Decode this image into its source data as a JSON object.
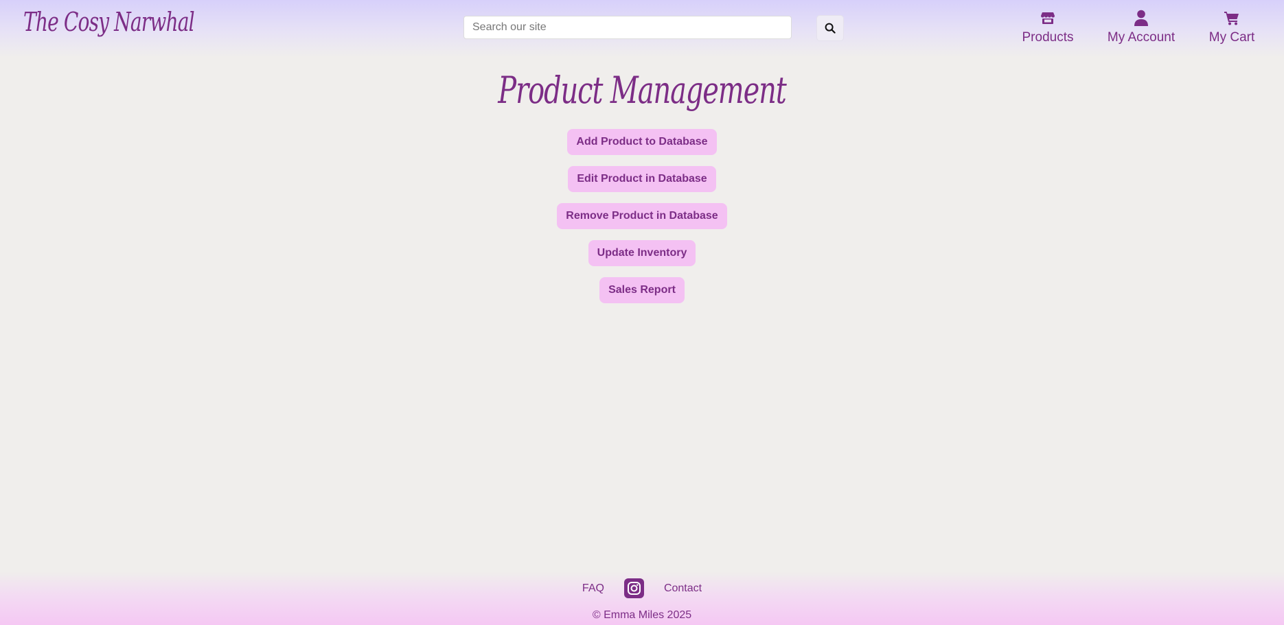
{
  "header": {
    "logo_text": "The Cosy Narwhal",
    "search": {
      "placeholder": "Search our site",
      "value": "",
      "button_icon": "search-icon"
    },
    "nav": [
      {
        "label": "Products",
        "icon": "store-icon"
      },
      {
        "label": "My Account",
        "icon": "user-icon"
      },
      {
        "label": "My Cart",
        "icon": "cart-icon"
      }
    ]
  },
  "main": {
    "title": "Product Management",
    "buttons": [
      {
        "label": "Add Product to Database"
      },
      {
        "label": "Edit Product in Database"
      },
      {
        "label": "Remove Product in Database"
      },
      {
        "label": "Update Inventory"
      },
      {
        "label": "Sales Report"
      }
    ]
  },
  "footer": {
    "links": [
      {
        "label": "FAQ"
      },
      {
        "label": "Contact"
      }
    ],
    "social_icon": "instagram-icon",
    "copyright": "© Emma Miles 2025"
  },
  "colors": {
    "brand": "#7c2d86",
    "button_bg": "#f4c1f3",
    "page_bg": "#f0eeec",
    "header_top": "#d7d0fa",
    "footer_bottom": "#f5c8f3"
  }
}
